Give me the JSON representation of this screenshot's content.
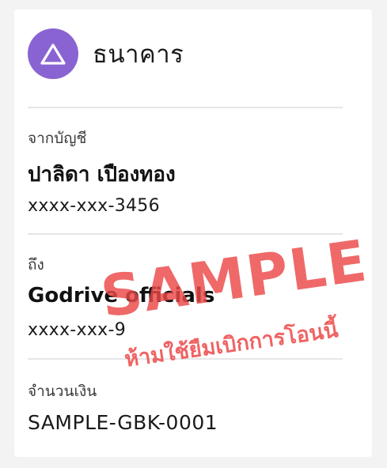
{
  "bank": {
    "name": "ธนาคาร",
    "logo_icon": "triangle-logo-icon",
    "logo_color": "#8a63d2"
  },
  "from": {
    "label": "จากบัญชี",
    "name": "ปาลิดา เปืองทอง",
    "account": "xxxx-xxx-3456"
  },
  "to": {
    "label": "ถึง",
    "name": "Godrive officials",
    "account": "xxxx-xxx-9"
  },
  "amount": {
    "label": "จำนวนเงิน",
    "value": "SAMPLE-GBK-0001"
  },
  "watermark": {
    "title": "SAMPLE",
    "subtitle": "ห้ามใช้ยืมเบิกการโอนนี้",
    "color": "#ec4848"
  }
}
